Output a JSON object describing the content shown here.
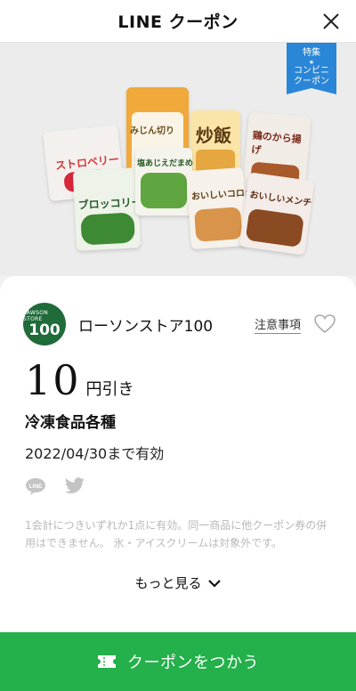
{
  "header": {
    "title": "LINE クーポン"
  },
  "hero": {
    "badge_line1": "特集",
    "badge_line2": "コンビニ",
    "badge_line3": "クーポン",
    "bags": [
      "ストロベリー",
      "みじん切り",
      "炒飯",
      "鶏のから揚げ",
      "ブロッコリー",
      "塩あじえだまめ",
      "おいしいコロッケ",
      "おいしいメンチ"
    ]
  },
  "coupon": {
    "logo_top": "LAWSON STORE",
    "logo_num": "100",
    "store_name": "ローソンストア100",
    "notes_label": "注意事項",
    "discount_value": "10",
    "discount_unit": "円引き",
    "product": "冷凍食品各種",
    "expiry": "2022/04/30まで有効",
    "share_line_label": "LINE",
    "terms": "1会計につきいずれか1点に有効。同一商品に他クーポン券の併用はできません。 氷・アイスクリームは対象外です。",
    "more_label": "もっと見る"
  },
  "footer": {
    "use_label": "クーポンをつかう"
  },
  "colors": {
    "accent": "#24b04a",
    "badge": "#2a86d6",
    "logo": "#1f6b3a"
  }
}
